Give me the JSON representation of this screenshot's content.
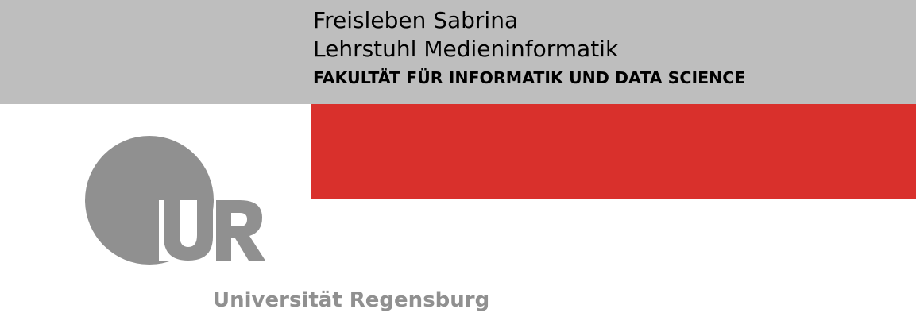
{
  "header": {
    "name": "Freisleben Sabrina",
    "chair": "Lehrstuhl Medieninformatik",
    "faculty": "FAKULTÄT FÜR INFORMATIK UND DATA SCIENCE"
  },
  "logo": {
    "letters": "UR",
    "university_name": "Universität Regensburg",
    "color": "#909090"
  },
  "colors": {
    "header_band": "#bebebe",
    "red_block": "#d9302c",
    "logo_gray": "#909090"
  }
}
